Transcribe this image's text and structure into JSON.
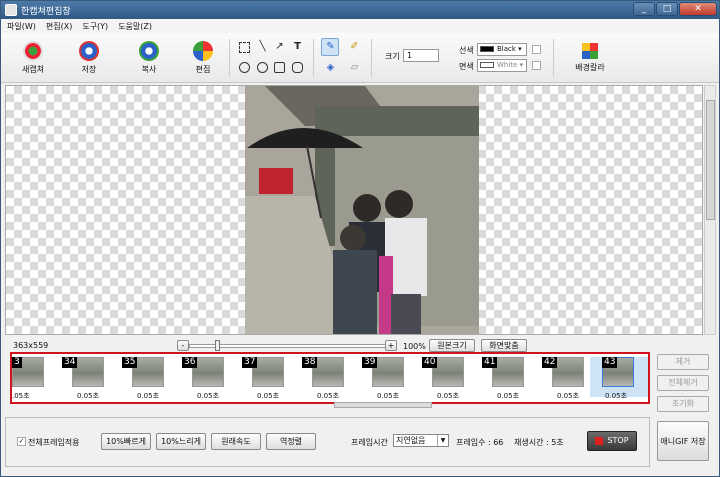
{
  "window": {
    "title": "한캡쳐편집창",
    "min": "_",
    "max": "□",
    "close": "✕"
  },
  "menu": [
    "파일(W)",
    "편집(X)",
    "도구(Y)",
    "도움말(Z)"
  ],
  "toolbar": {
    "capture": "새캡쳐",
    "save": "저장",
    "copy": "복사",
    "edit": "편집",
    "size_label": "크기",
    "size_value": "1",
    "line_label": "선색",
    "line_color": "Black",
    "fill_label": "면색",
    "fill_color": "White",
    "bg_label": "배경칼라"
  },
  "canvas": {
    "dimensions": "363x559"
  },
  "zoom": {
    "minus": "-",
    "plus": "+",
    "percent": "100%",
    "original": "원본크기",
    "fit": "화면맞춤"
  },
  "frames": [
    {
      "num": "3",
      "dur": ".05초"
    },
    {
      "num": "34",
      "dur": "0.05초"
    },
    {
      "num": "35",
      "dur": "0.05초"
    },
    {
      "num": "36",
      "dur": "0.05초"
    },
    {
      "num": "37",
      "dur": "0.05초"
    },
    {
      "num": "38",
      "dur": "0.05초"
    },
    {
      "num": "39",
      "dur": "0.05초"
    },
    {
      "num": "40",
      "dur": "0.05초"
    },
    {
      "num": "41",
      "dur": "0.05초"
    },
    {
      "num": "42",
      "dur": "0.05초"
    },
    {
      "num": "43",
      "dur": "0.05초"
    }
  ],
  "side": {
    "remove": "제거",
    "remove_all": "전체제거",
    "reset": "초기화"
  },
  "bottom": {
    "apply_all": "전체프레임적용",
    "faster": "10%빠르게",
    "slower": "10%느리게",
    "original_speed": "원래속도",
    "reverse": "역정렬",
    "frame_time_label": "프레임시간",
    "frame_time_value": "지연없음",
    "frame_count": "프레임수 : 66",
    "play_time": "재생시간 : 5초",
    "stop": "STOP",
    "save_gif": "애니GIF 저장"
  },
  "colors": {
    "title": "#3a6592",
    "strip_border": "#d0141e",
    "stop_square": "#e02020"
  }
}
